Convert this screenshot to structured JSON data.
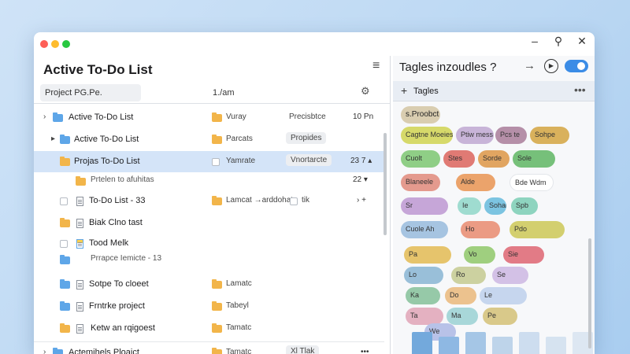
{
  "window": {
    "controls": {
      "min": "–",
      "pin": "⚲",
      "close": "✕"
    }
  },
  "left": {
    "title": "Active To-Do List",
    "menu_icon": "≡",
    "search_value": "Project PG.Pe.",
    "column_header": "1./am",
    "settings_icon": "⚙",
    "rows": [
      {
        "name": "Active To-Do List",
        "col2": "Vuray",
        "col3": "Precisbtce",
        "num": "10 Pn"
      },
      {
        "name": "Active To-Do List",
        "col2": "Parcats",
        "col3": "Propides",
        "num": ""
      },
      {
        "name": "Projas To-Do List",
        "col2": "Yamrate",
        "col3": "Vnortarcte",
        "num": "23 7 ▴"
      },
      {
        "name": "Prtelen to afuhitas",
        "col2": "",
        "col3": "",
        "num": "22 ▾"
      },
      {
        "name": "To-Do List - 33",
        "col2": "Lamcat →arddohats",
        "col3": "tik",
        "num": "› +"
      },
      {
        "name": "Biak Clno tast",
        "col2": "",
        "col3": "",
        "num": ""
      },
      {
        "name": "Tood Melk",
        "col2": "",
        "col3": "",
        "num": ""
      },
      {
        "name": "Prrapce Iemicte - 13",
        "col2": "",
        "col3": "",
        "num": ""
      },
      {
        "name": "Sotpe To cloeet",
        "col2": "Lamatc",
        "col3": "",
        "num": ""
      },
      {
        "name": "Frntrke project",
        "col2": "Tabeyl",
        "col3": "",
        "num": ""
      },
      {
        "name": "Ketw an rqigoest",
        "col2": "Tamatc",
        "col3": "",
        "num": ""
      },
      {
        "name": "Actemihels Ploaict",
        "col2": "Tamatc",
        "col3": "Xl Tlak",
        "num": "•••"
      }
    ]
  },
  "right": {
    "title": "Tagles inzoudles ?",
    "arrow_icon": "→",
    "play_icon": "▶",
    "header_plus": "+",
    "header_title": "Tagles",
    "header_dots": "•••",
    "tags": [
      {
        "label": "s.Proobct",
        "color": "#d9cdb0"
      },
      {
        "label": "Cagtne Moeieslc",
        "color": "#d6d96a"
      },
      {
        "label": "Ptiw mess",
        "color": "#c8b4d8"
      },
      {
        "label": "Pcs te",
        "color": "#b58fa8"
      },
      {
        "label": "Sohpe",
        "color": "#d9b15c"
      },
      {
        "label": "Cuolt",
        "color": "#8fce86"
      },
      {
        "label": "Stes",
        "color": "#e07a74"
      },
      {
        "label": "Sorde",
        "color": "#e1a561"
      },
      {
        "label": "Sole",
        "color": "#76c07a"
      },
      {
        "label": "Blaneele",
        "color": "#e49a8e"
      },
      {
        "label": "Alde",
        "color": "#eba36b"
      },
      {
        "label": "Bde Wdm",
        "color": "#ffffff"
      },
      {
        "label": "Sr",
        "color": "#c6a6d8"
      },
      {
        "label": "Ie",
        "color": "#9fdcd0"
      },
      {
        "label": "Sohaie",
        "color": "#7cc4e1"
      },
      {
        "label": "Spb",
        "color": "#8ed4bf"
      },
      {
        "label": "Cuole Ah",
        "color": "#a6c4e1"
      },
      {
        "label": "Ho",
        "color": "#eb9b84"
      },
      {
        "label": "Pdo",
        "color": "#d3cf6f"
      },
      {
        "label": "Pa",
        "color": "#e6c46c"
      },
      {
        "label": "Vo",
        "color": "#9fcf7f"
      },
      {
        "label": "Sie",
        "color": "#e27b86"
      },
      {
        "label": "Lo",
        "color": "#99bfd9"
      },
      {
        "label": "Ro",
        "color": "#ccd1a0"
      },
      {
        "label": "Se",
        "color": "#d3c1e6"
      },
      {
        "label": "Ka",
        "color": "#96c9a8"
      },
      {
        "label": "Do",
        "color": "#ecc28e"
      },
      {
        "label": "Le",
        "color": "#c6d6ee"
      },
      {
        "label": "Ta",
        "color": "#e4b1c1"
      },
      {
        "label": "Ma",
        "color": "#a8d7d9"
      },
      {
        "label": "Pe",
        "color": "#d9c98a"
      },
      {
        "label": "We",
        "color": "#b8c2e8"
      }
    ],
    "tile_colors": [
      "#73a9dc",
      "#8eb8e3",
      "#a5c6e6",
      "#bed4ea",
      "#cdddef",
      "#d6e3f0",
      "#dde7f2"
    ]
  },
  "colors": {
    "accent": "#3b8ce6",
    "selection": "#d4e4f8"
  }
}
